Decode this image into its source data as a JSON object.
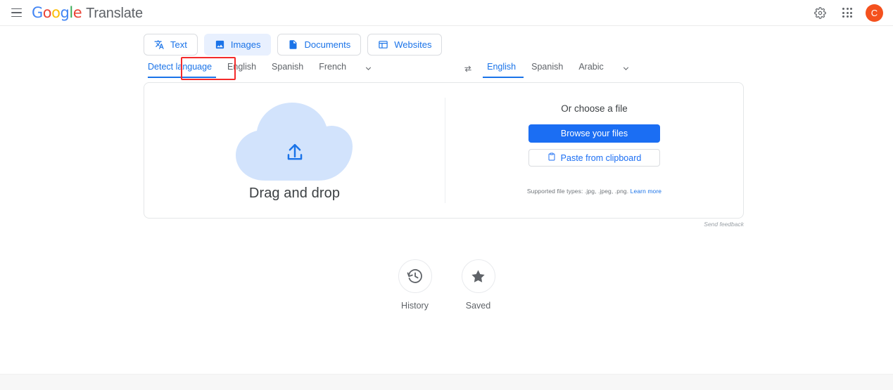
{
  "header": {
    "menu_icon": "hamburger-menu-icon",
    "logo_letters": [
      "G",
      "o",
      "o",
      "g",
      "l",
      "e"
    ],
    "product_name": "Translate",
    "settings_icon": "gear-icon",
    "apps_icon": "apps-grid-icon",
    "avatar_initial": "C",
    "avatar_color": "#f4511e"
  },
  "tabs": [
    {
      "label": "Text",
      "icon": "translate-icon",
      "active": false
    },
    {
      "label": "Images",
      "icon": "image-icon",
      "active": true
    },
    {
      "label": "Documents",
      "icon": "document-icon",
      "active": false
    },
    {
      "label": "Websites",
      "icon": "website-icon",
      "active": false
    }
  ],
  "annotation": {
    "target": "Images",
    "color": "#f42a2a"
  },
  "source_languages": {
    "items": [
      "Detect language",
      "English",
      "Spanish",
      "French"
    ],
    "active": "Detect language",
    "more_icon": "chevron-down-icon"
  },
  "target_languages": {
    "swap_icon": "swap-arrows-icon",
    "items": [
      "English",
      "Spanish",
      "Arabic"
    ],
    "active": "English",
    "more_icon": "chevron-down-icon"
  },
  "dropzone": {
    "title": "Drag and drop",
    "cloud_color": "#d2e3fc",
    "upload_icon": "upload-arrow-icon"
  },
  "choose_file": {
    "title": "Or choose a file",
    "browse_label": "Browse your files",
    "paste_label": "Paste from clipboard",
    "paste_icon": "clipboard-icon",
    "supported_text": "Supported file types: .jpg, .jpeg, .png.",
    "learn_more": "Learn more",
    "primary_color": "#1b6ef3"
  },
  "send_feedback": "Send feedback",
  "shortcuts": [
    {
      "label": "History",
      "icon": "history-clock-icon"
    },
    {
      "label": "Saved",
      "icon": "star-icon"
    }
  ]
}
